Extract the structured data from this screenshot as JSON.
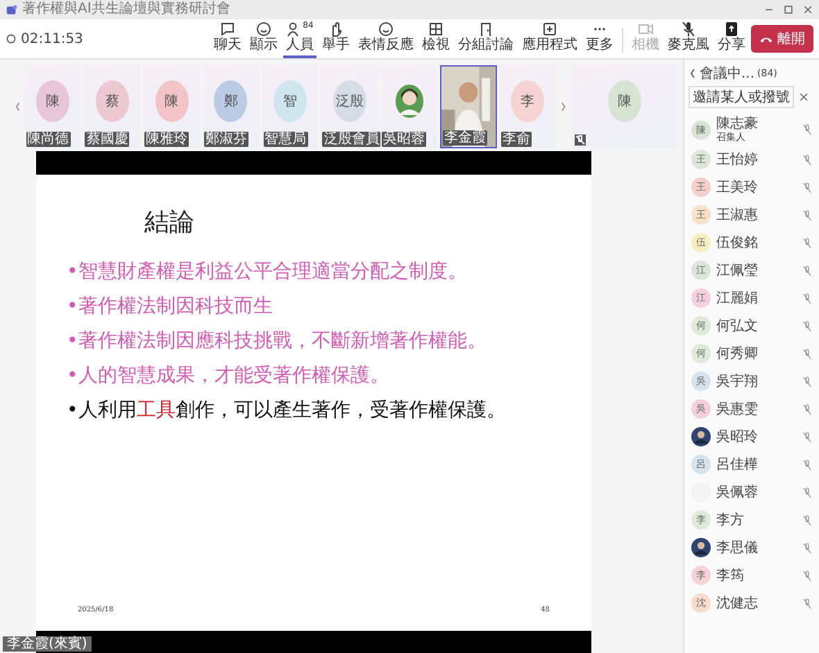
{
  "window": {
    "title": "著作權與AI共生論壇與實務研討會"
  },
  "meeting": {
    "timer": "02:11:53"
  },
  "toolbar": [
    {
      "label": "聊天",
      "selected": false
    },
    {
      "label": "顯示",
      "selected": false
    },
    {
      "label": "人員",
      "count": "84",
      "selected": true
    },
    {
      "label": "舉手",
      "selected": false
    },
    {
      "label": "表情反應",
      "selected": false
    },
    {
      "label": "檢視",
      "selected": false
    },
    {
      "label": "分組討論",
      "selected": false
    },
    {
      "label": "應用程式",
      "selected": false
    },
    {
      "label": "更多",
      "selected": false
    }
  ],
  "devices": [
    {
      "label": "相機",
      "disabled": true
    },
    {
      "label": "麥克風",
      "disabled": false
    },
    {
      "label": "分享",
      "disabled": false
    }
  ],
  "leave_button": {
    "label": "離開"
  },
  "strip": [
    {
      "kind": "avatar",
      "initial": "陳",
      "name": "陳尚德",
      "color": "#e7c6d8",
      "selected": false
    },
    {
      "kind": "avatar",
      "initial": "蔡",
      "name": "蔡國慶",
      "color": "#ecc8d3",
      "selected": false
    },
    {
      "kind": "avatar",
      "initial": "陳",
      "name": "陳雅玲",
      "color": "#f2c4c8",
      "selected": false
    },
    {
      "kind": "avatar",
      "initial": "鄭",
      "name": "鄭淑芬",
      "color": "#bccbe6",
      "selected": false
    },
    {
      "kind": "avatar",
      "initial": "智",
      "name": "智慧局",
      "color": "#cfe6ef",
      "selected": false
    },
    {
      "kind": "avatar",
      "initial": "泛殷",
      "name": "泛殷會員",
      "color": "#d6dce6",
      "selected": false
    },
    {
      "name": "吳昭蓉",
      "selected": false
    },
    {
      "kind": "video",
      "name": "李金霞",
      "selected": true
    },
    {
      "kind": "avatar",
      "initial": "李",
      "name": "李俞",
      "color": "#f6d3d3",
      "selected": false
    }
  ],
  "strip_overflow": {
    "initial": "陳",
    "color": "#d7e3d3"
  },
  "slide": {
    "title": "結論",
    "bullets": [
      {
        "bullet": "•",
        "color": "#d25cb4",
        "parts": [
          {
            "text": "智慧財產權是利益公平合理適當分配之制度。",
            "emphasis": false
          }
        ]
      },
      {
        "bullet": "•",
        "color": "#d25cb4",
        "parts": [
          {
            "text": "著作權法制因科技而生",
            "emphasis": false
          }
        ]
      },
      {
        "bullet": "•",
        "color": "#d25cb4",
        "parts": [
          {
            "text": "著作權法制因應科技挑戰，不斷新增著作權能。",
            "emphasis": false
          }
        ]
      },
      {
        "bullet": "•",
        "color": "#d25cb4",
        "parts": [
          {
            "text": "人的智慧成果，才能受著作權保護。",
            "emphasis": false
          }
        ]
      },
      {
        "bullet": "•",
        "color": "#111111",
        "parts": [
          {
            "text": "人利用",
            "emphasis": false
          },
          {
            "text": "工具",
            "emphasis": true
          },
          {
            "text": "創作，可以產生著作，受著作權保護。",
            "emphasis": false
          }
        ]
      }
    ],
    "date": "2025/6/18",
    "page": "48"
  },
  "self_view": {
    "name": "李金霞(來賓)"
  },
  "people_panel": {
    "title": "會議中...",
    "count": "(84)",
    "invite_button": "邀請某人或撥號",
    "participants": [
      {
        "kind": "avatar",
        "initial": "陳",
        "name": "陳志豪",
        "role": "召集人",
        "color": "#d9e4d6"
      },
      {
        "kind": "avatar",
        "initial": "王",
        "name": "王怡婷",
        "color": "#dde6d9"
      },
      {
        "kind": "avatar",
        "initial": "王",
        "name": "王美玲",
        "color": "#f4cfcb"
      },
      {
        "kind": "avatar",
        "initial": "王",
        "name": "王淑惠",
        "color": "#f9e0c8"
      },
      {
        "kind": "avatar",
        "initial": "伍",
        "name": "伍俊銘",
        "color": "#f8efc0"
      },
      {
        "kind": "avatar",
        "initial": "江",
        "name": "江佩瑩",
        "color": "#dbe5da"
      },
      {
        "kind": "avatar",
        "initial": "江",
        "name": "江麗娟",
        "color": "#f6d0df"
      },
      {
        "kind": "avatar",
        "initial": "何",
        "name": "何弘文",
        "color": "#dfead8"
      },
      {
        "kind": "avatar",
        "initial": "何",
        "name": "何秀卿",
        "color": "#dfead8"
      },
      {
        "kind": "avatar",
        "initial": "吳",
        "name": "吳宇翔",
        "color": "#d5e3ee"
      },
      {
        "kind": "avatar",
        "initial": "吳",
        "name": "吳惠雯",
        "color": "#f6cfdc"
      },
      {
        "name": "吳昭玲"
      },
      {
        "kind": "avatar",
        "initial": "呂",
        "name": "呂佳樺",
        "color": "#d5e3ee"
      },
      {
        "kind": "blank",
        "name": "吳佩蓉"
      },
      {
        "kind": "avatar",
        "initial": "李",
        "name": "李方",
        "color": "#dfead8"
      },
      {
        "name": "李思儀"
      },
      {
        "kind": "avatar",
        "initial": "李",
        "name": "李筠",
        "color": "#f6d3d6"
      },
      {
        "kind": "avatar",
        "initial": "沈",
        "name": "沈健志",
        "color": "#f9dccb"
      }
    ]
  }
}
